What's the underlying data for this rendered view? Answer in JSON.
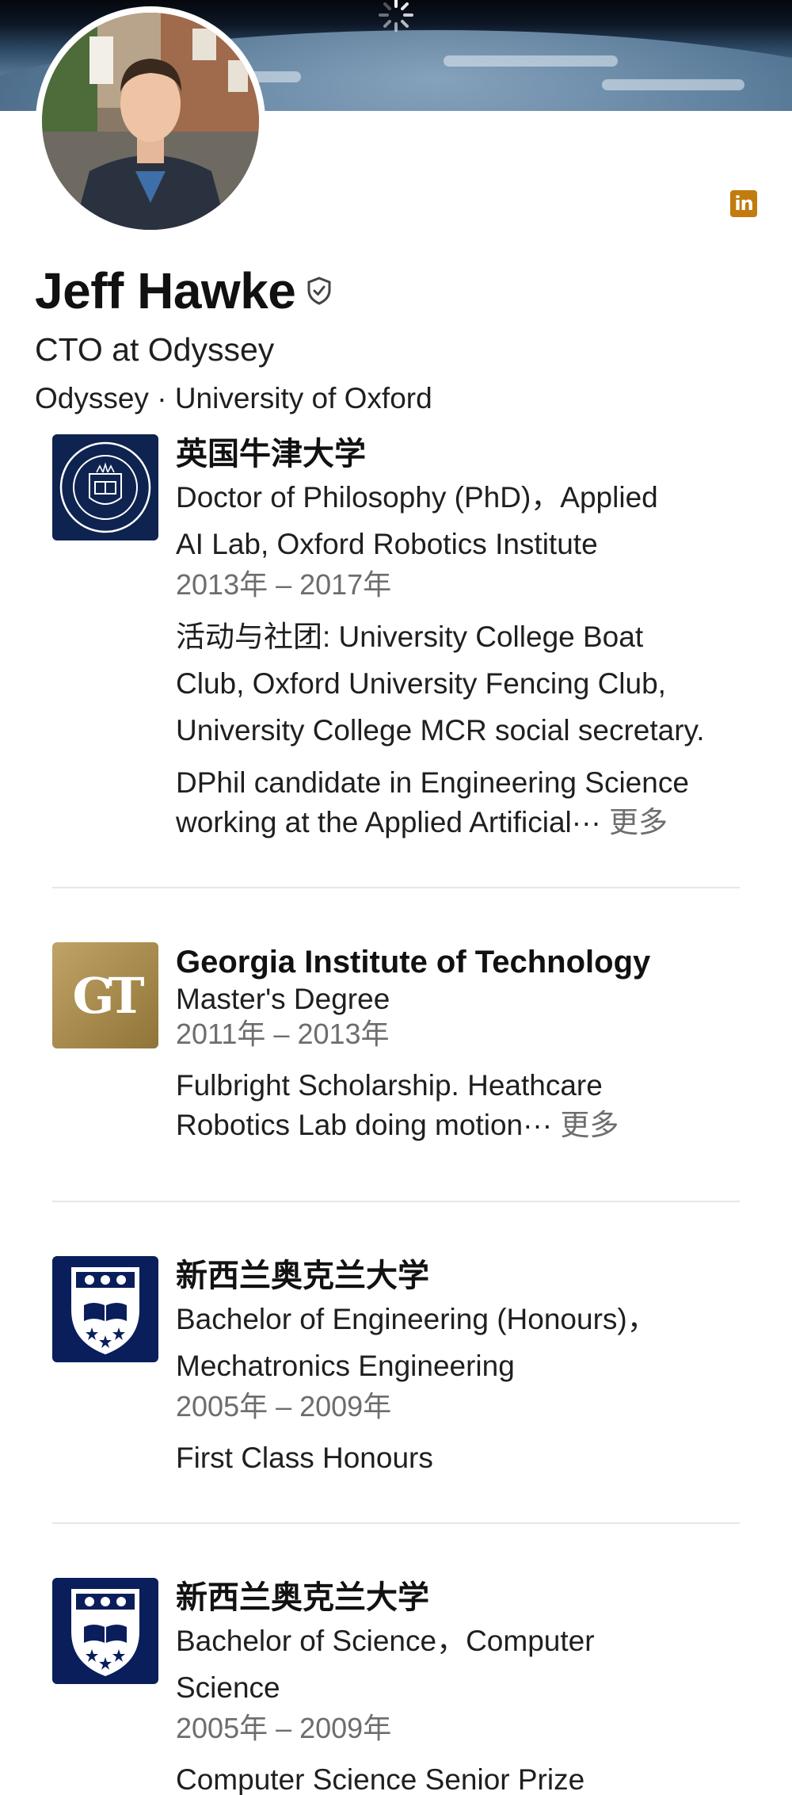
{
  "profile": {
    "name": "Jeff Hawke",
    "headline": "CTO at Odyssey",
    "subline": "Odyssey · University of Oxford"
  },
  "colors": {
    "oxford_blue": "#0f2350",
    "gt_gold": "#b09250",
    "auckland_blue": "#0a1e5c",
    "linkedin_badge": "#c27b0e"
  },
  "icons": {
    "verified": "shield-check-icon",
    "linkedin": "linkedin-icon",
    "loading": "spinner-icon"
  },
  "linkedin_label": "in",
  "education": [
    {
      "school": "英国牛津大学",
      "degree_line1": "Doctor of Philosophy (PhD)，Applied",
      "degree_line2": "AI Lab, Oxford Robotics Institute",
      "dates": "2013年 – 2017年",
      "activities_line1": "活动与社团: University College Boat",
      "activities_line2": "Club, Oxford University Fencing Club,",
      "activities_line3": "University College MCR social secretary.",
      "desc_line1": "DPhil candidate in Engineering Science",
      "desc_line2": "working at the Applied Artificial···",
      "more": "更多"
    },
    {
      "school": "Georgia Institute of Technology",
      "degree_line1": "Master's Degree",
      "dates": "2011年 – 2013年",
      "desc_line1": "Fulbright Scholarship. Heathcare",
      "desc_line2": "Robotics Lab doing motion···",
      "more": "更多",
      "logo_text": "GT"
    },
    {
      "school": "新西兰奥克兰大学",
      "degree_line1": "Bachelor of Engineering (Honours)，",
      "degree_line2": "Mechatronics Engineering",
      "dates": "2005年 – 2009年",
      "desc_line1": "First Class Honours"
    },
    {
      "school": "新西兰奥克兰大学",
      "degree_line1": "Bachelor of Science，Computer",
      "degree_line2": "Science",
      "dates": "2005年 – 2009年",
      "desc_line1": "Computer Science Senior Prize"
    }
  ]
}
